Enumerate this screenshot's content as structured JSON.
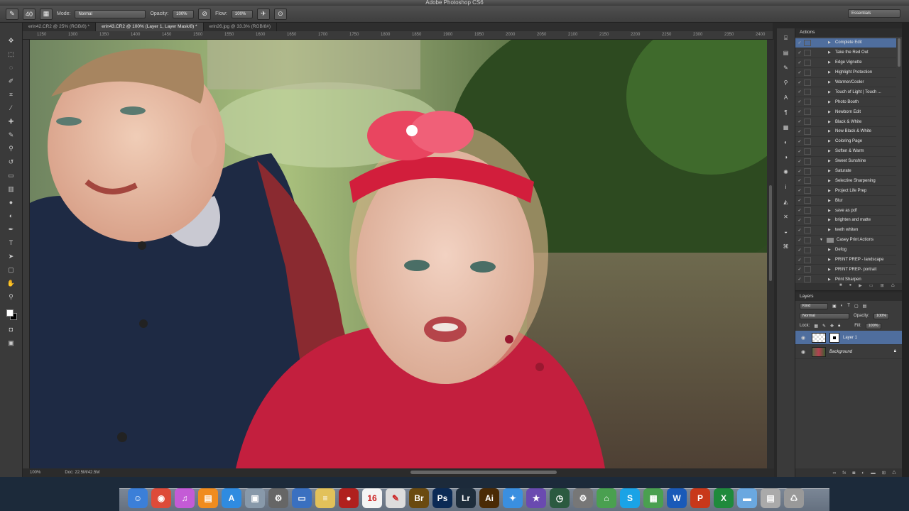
{
  "app": {
    "title": "Adobe Photoshop CS6"
  },
  "options": {
    "mode_label": "Mode:",
    "mode_value": "Normal",
    "opacity_label": "Opacity:",
    "opacity_value": "100%",
    "flow_label": "Flow:",
    "flow_value": "100%",
    "brush_size": "40",
    "workspace": "Essentials"
  },
  "tabs": [
    {
      "label": "erin42.CR2 @ 25% (RGB/8) *"
    },
    {
      "label": "erin43.CR2 @ 100% (Layer 1, Layer Mask/8) *"
    },
    {
      "label": "erin26.jpg @ 33.3% (RGB/8#)"
    }
  ],
  "ruler": [
    "1250",
    "1300",
    "1350",
    "1400",
    "1450",
    "1500",
    "1550",
    "1600",
    "1650",
    "1700",
    "1750",
    "1800",
    "1850",
    "1900",
    "1950",
    "2000",
    "2050",
    "2100",
    "2150",
    "2200",
    "2250",
    "2300",
    "2350",
    "2400"
  ],
  "status": {
    "zoom": "100%",
    "doc": "Doc: 22.5M/42.5M"
  },
  "actions_panel": {
    "title": "Actions",
    "items": [
      {
        "label": "Complete Edit",
        "selected": true
      },
      {
        "label": "Take the Red Out"
      },
      {
        "label": "Edge Vignette"
      },
      {
        "label": "Highlight Protection"
      },
      {
        "label": "Warmer/Cooler"
      },
      {
        "label": "Touch of Light | Touch ..."
      },
      {
        "label": "Photo Booth"
      },
      {
        "label": "Newborn Edit"
      },
      {
        "label": "Black & White"
      },
      {
        "label": "New Black & White"
      },
      {
        "label": "Coloring Page"
      },
      {
        "label": "Soften & Warm"
      },
      {
        "label": "Sweet Sunshine"
      },
      {
        "label": "Saturate"
      },
      {
        "label": "Selective Sharpening"
      },
      {
        "label": "Project Life Prep"
      },
      {
        "label": "Blur"
      },
      {
        "label": "save as pdf"
      },
      {
        "label": "brighten and matte"
      },
      {
        "label": "teeth whiten"
      },
      {
        "label": "Casey Print Actions",
        "set": true
      },
      {
        "label": "Defog"
      },
      {
        "label": "PRINT PREP - landscape"
      },
      {
        "label": "PRINT PREP- portrait"
      },
      {
        "label": "Print Sharpen"
      }
    ]
  },
  "layers_panel": {
    "title": "Layers",
    "kind": "Kind",
    "blend": "Normal",
    "opacity_label": "Opacity:",
    "opacity_value": "100%",
    "lock_label": "Lock:",
    "fill_label": "Fill:",
    "fill_value": "100%",
    "layers": [
      {
        "name": "Layer 1",
        "selected": true
      },
      {
        "name": "Background"
      }
    ]
  },
  "dock": [
    {
      "name": "finder",
      "glyph": "☺",
      "color": "#3b7fd8"
    },
    {
      "name": "chrome",
      "glyph": "◉",
      "color": "#dd4b39"
    },
    {
      "name": "itunes",
      "glyph": "♫",
      "color": "#c45bd6"
    },
    {
      "name": "ibooks",
      "glyph": "▤",
      "color": "#f08c1e"
    },
    {
      "name": "app-store",
      "glyph": "A",
      "color": "#2f8be0"
    },
    {
      "name": "preview",
      "glyph": "▣",
      "color": "#8899aa"
    },
    {
      "name": "automator",
      "glyph": "⚙",
      "color": "#666"
    },
    {
      "name": "keynote",
      "glyph": "▭",
      "color": "#3a70c0"
    },
    {
      "name": "notes",
      "glyph": "≡",
      "color": "#e2c15a"
    },
    {
      "name": "photo-booth",
      "glyph": "●",
      "color": "#b0201e"
    },
    {
      "name": "calendar",
      "glyph": "16",
      "color": "#f4f4f4"
    },
    {
      "name": "textedit",
      "glyph": "✎",
      "color": "#ddd"
    },
    {
      "name": "bridge",
      "glyph": "Br",
      "color": "#6a4a10"
    },
    {
      "name": "photoshop",
      "glyph": "Ps",
      "color": "#0b2a55"
    },
    {
      "name": "lightroom",
      "glyph": "Lr",
      "color": "#1e2d3c"
    },
    {
      "name": "illustrator",
      "glyph": "Ai",
      "color": "#4a2a05"
    },
    {
      "name": "safari",
      "glyph": "✦",
      "color": "#3a8fe0"
    },
    {
      "name": "imovie",
      "glyph": "★",
      "color": "#6a4ab0"
    },
    {
      "name": "time-machine",
      "glyph": "◷",
      "color": "#2b5a40"
    },
    {
      "name": "settings",
      "glyph": "⚙",
      "color": "#777"
    },
    {
      "name": "maps",
      "glyph": "⌂",
      "color": "#4aa050"
    },
    {
      "name": "skype",
      "glyph": "S",
      "color": "#1aa3e6"
    },
    {
      "name": "image-capture",
      "glyph": "▦",
      "color": "#4aa050"
    },
    {
      "name": "word",
      "glyph": "W",
      "color": "#1a5ab8"
    },
    {
      "name": "powerpoint",
      "glyph": "P",
      "color": "#c8381a"
    },
    {
      "name": "excel",
      "glyph": "X",
      "color": "#1f8a3c"
    },
    {
      "name": "folder",
      "glyph": "▬",
      "color": "#6aa8e0"
    },
    {
      "name": "downloads",
      "glyph": "▤",
      "color": "#aaa"
    },
    {
      "name": "trash",
      "glyph": "♺",
      "color": "#999"
    }
  ],
  "colors": {
    "accent": "#4f6e9e",
    "panel": "#3b3b3b"
  }
}
